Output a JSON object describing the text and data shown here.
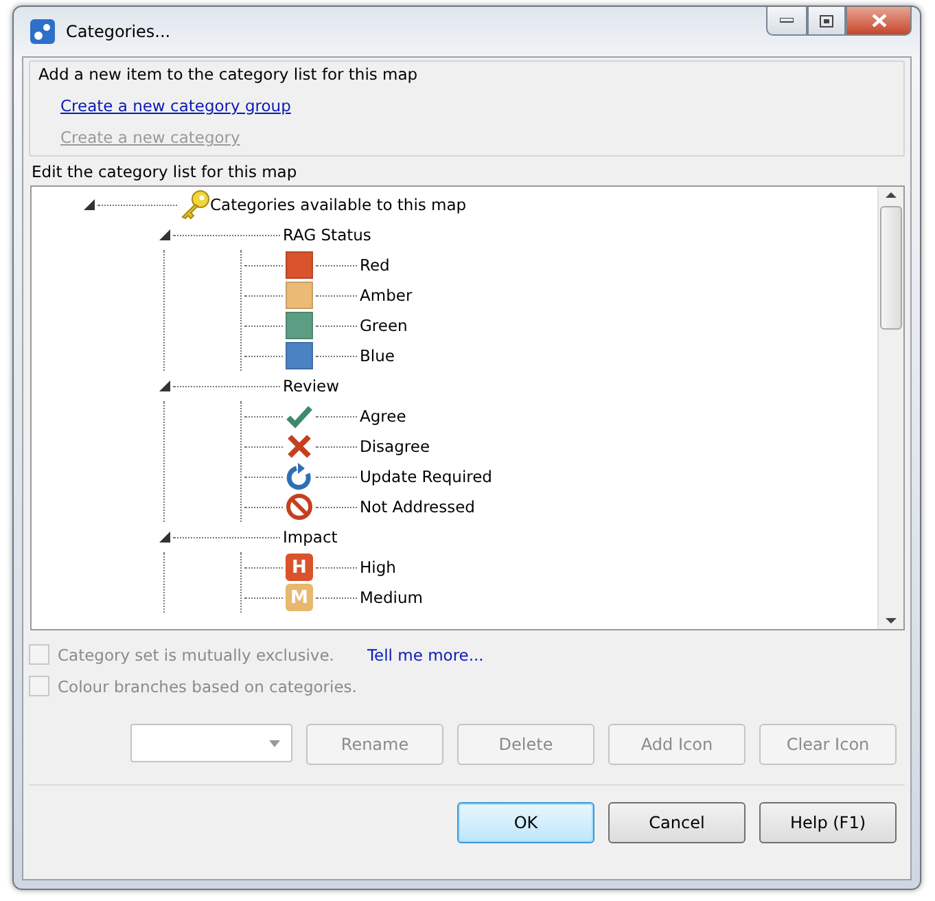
{
  "window": {
    "title": "Categories..."
  },
  "add_section": {
    "title": "Add a new item to the category list for this map",
    "links": [
      {
        "label": "Create a new category group",
        "disabled": false
      },
      {
        "label": "Create a new category",
        "disabled": true
      }
    ]
  },
  "edit_section": {
    "title": "Edit the category list for this map"
  },
  "tree": {
    "label": "Categories available to this map",
    "expanded": true,
    "children": [
      {
        "label": "RAG Status",
        "expanded": true,
        "children": [
          {
            "label": "Red",
            "kind": "swatch",
            "color": "#d9532c"
          },
          {
            "label": "Amber",
            "kind": "swatch",
            "color": "#ebbb76"
          },
          {
            "label": "Green",
            "kind": "swatch",
            "color": "#5c9e84"
          },
          {
            "label": "Blue",
            "kind": "swatch",
            "color": "#4a82c4"
          }
        ]
      },
      {
        "label": "Review",
        "expanded": true,
        "children": [
          {
            "label": "Agree",
            "kind": "check"
          },
          {
            "label": "Disagree",
            "kind": "cross"
          },
          {
            "label": "Update Required",
            "kind": "refresh"
          },
          {
            "label": "Not Addressed",
            "kind": "no-entry"
          }
        ]
      },
      {
        "label": "Impact",
        "expanded": true,
        "children": [
          {
            "label": "High",
            "kind": "letter",
            "letter": "H",
            "color": "#d9532c"
          },
          {
            "label": "Medium",
            "kind": "letter",
            "letter": "M",
            "color": "#e8b86e"
          }
        ]
      }
    ]
  },
  "options": [
    {
      "label": "Category set is mutually exclusive.",
      "checked": false,
      "disabled": true,
      "link": "Tell me more..."
    },
    {
      "label": "Colour branches based on categories.",
      "checked": false,
      "disabled": true
    }
  ],
  "actions": {
    "buttons": [
      {
        "label": "Rename",
        "disabled": true
      },
      {
        "label": "Delete",
        "disabled": true
      },
      {
        "label": "Add Icon",
        "disabled": true
      },
      {
        "label": "Clear Icon",
        "disabled": true
      }
    ]
  },
  "footer": {
    "buttons": [
      {
        "label": "OK",
        "default": true
      },
      {
        "label": "Cancel",
        "default": false
      },
      {
        "label": "Help (F1)",
        "default": false
      }
    ]
  }
}
